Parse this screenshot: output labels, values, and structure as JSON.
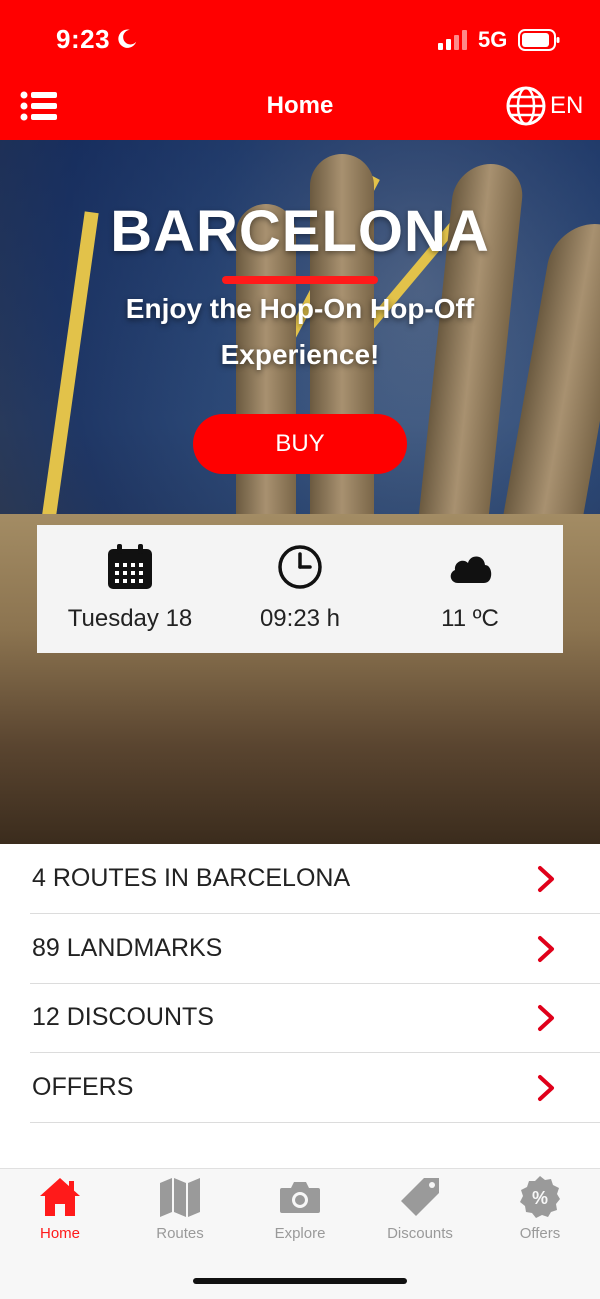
{
  "status": {
    "time": "9:23",
    "network": "5G"
  },
  "header": {
    "title": "Home",
    "language": "EN"
  },
  "hero": {
    "city": "BARCELONA",
    "tagline": "Enjoy the Hop-On Hop-Off Experience!",
    "buy_label": "BUY"
  },
  "info": {
    "date": "Tuesday 18",
    "time": "09:23 h",
    "temperature": "11 ºC"
  },
  "list": [
    {
      "label": "4 ROUTES IN BARCELONA"
    },
    {
      "label": "89 LANDMARKS"
    },
    {
      "label": "12 DISCOUNTS"
    },
    {
      "label": "OFFERS"
    }
  ],
  "tabs": [
    {
      "label": "Home",
      "icon": "home-icon",
      "active": true
    },
    {
      "label": "Routes",
      "icon": "map-icon",
      "active": false
    },
    {
      "label": "Explore",
      "icon": "camera-icon",
      "active": false
    },
    {
      "label": "Discounts",
      "icon": "tag-icon",
      "active": false
    },
    {
      "label": "Offers",
      "icon": "percent-badge-icon",
      "active": false
    }
  ],
  "colors": {
    "brand": "#ff0000",
    "tab_inactive": "#9a9a9a",
    "chevron": "#e0001a"
  }
}
